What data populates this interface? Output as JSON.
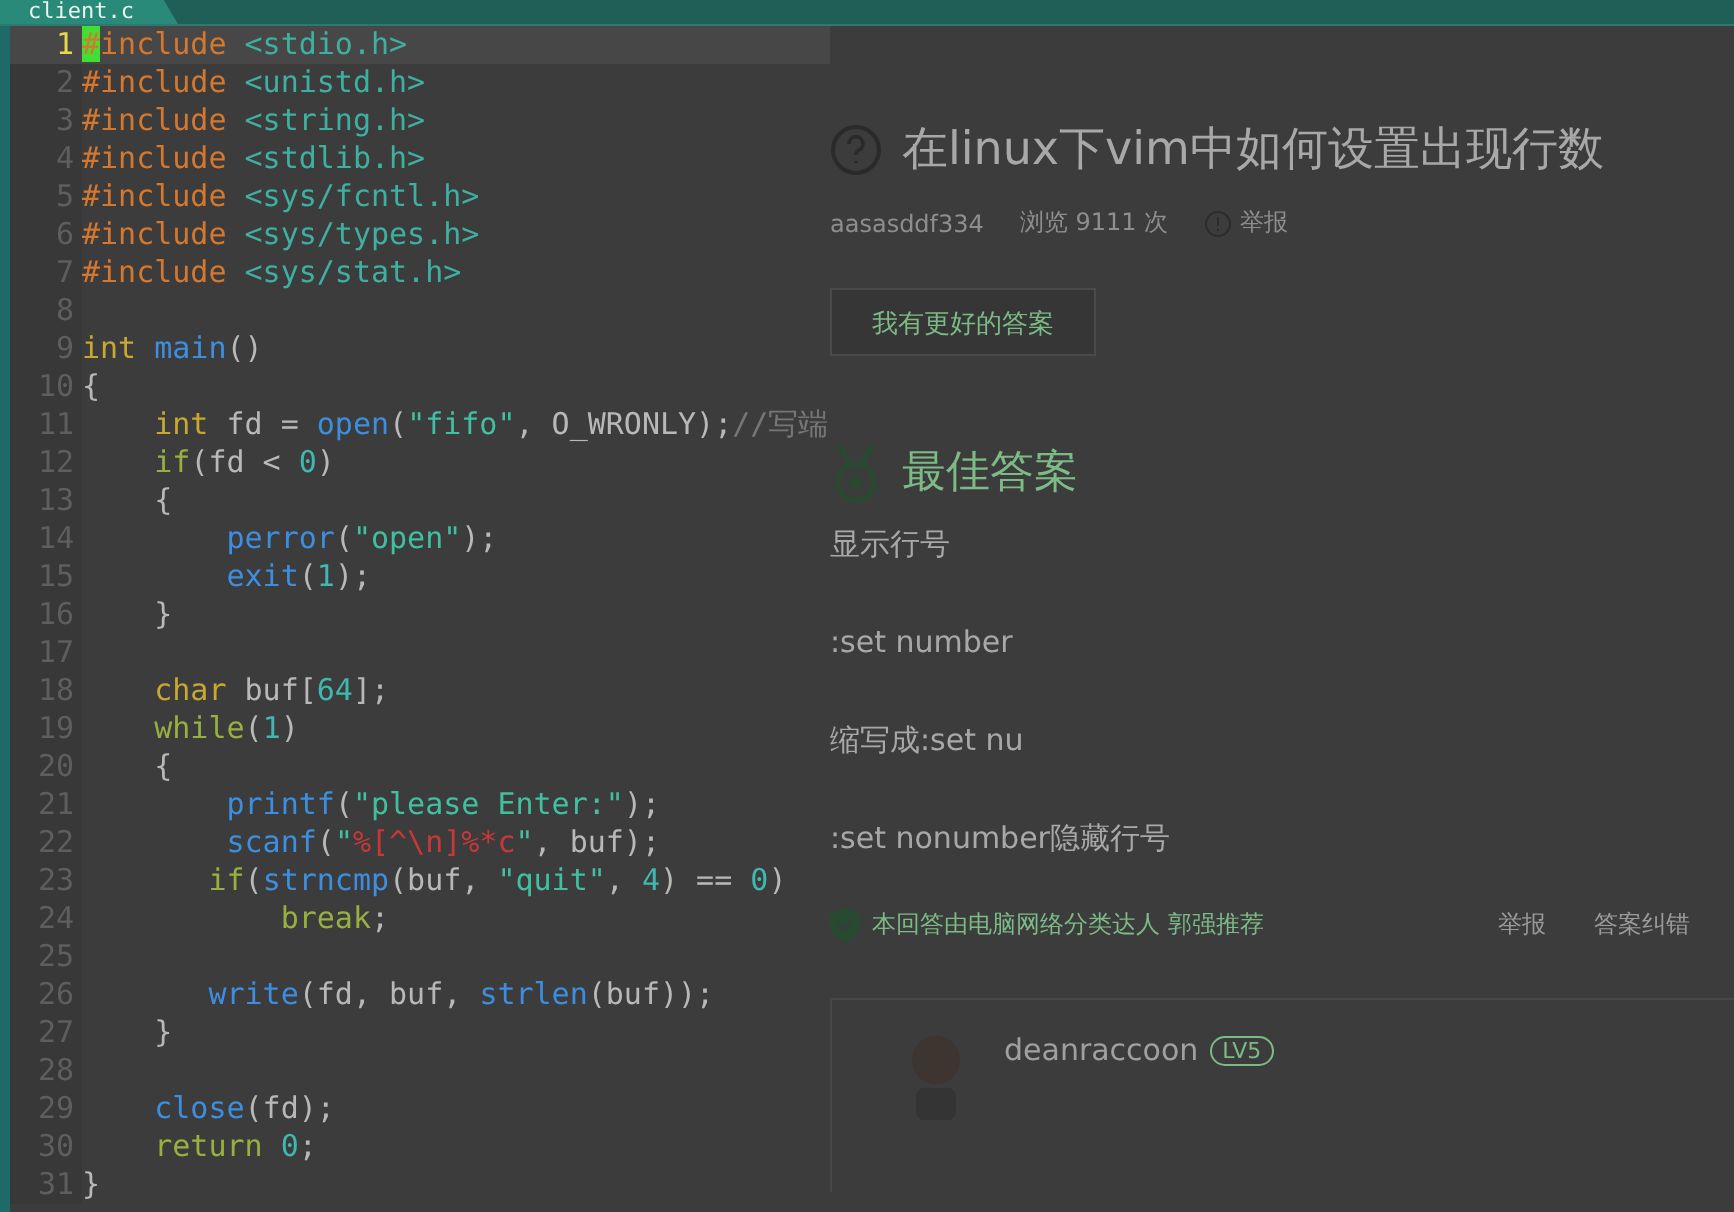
{
  "editor": {
    "tab": {
      "label": "client.c"
    },
    "lines": [
      {
        "number": "1",
        "current": true,
        "tokens": [
          {
            "text": "#",
            "kind": "cursor"
          },
          {
            "text": "include",
            "kind": "preproc"
          },
          {
            "text": " <stdio.h>",
            "kind": "header"
          }
        ]
      },
      {
        "number": "2",
        "current": false,
        "tokens": [
          {
            "text": "#include",
            "kind": "preproc"
          },
          {
            "text": " <unistd.h>",
            "kind": "header"
          }
        ]
      },
      {
        "number": "3",
        "current": false,
        "tokens": [
          {
            "text": "#include",
            "kind": "preproc"
          },
          {
            "text": " <string.h>",
            "kind": "header"
          }
        ]
      },
      {
        "number": "4",
        "current": false,
        "tokens": [
          {
            "text": "#include",
            "kind": "preproc"
          },
          {
            "text": " <stdlib.h>",
            "kind": "header"
          }
        ]
      },
      {
        "number": "5",
        "current": false,
        "tokens": [
          {
            "text": "#include",
            "kind": "preproc"
          },
          {
            "text": " <sys/fcntl.h>",
            "kind": "header"
          }
        ]
      },
      {
        "number": "6",
        "current": false,
        "tokens": [
          {
            "text": "#include",
            "kind": "preproc"
          },
          {
            "text": " <sys/types.h>",
            "kind": "header"
          }
        ]
      },
      {
        "number": "7",
        "current": false,
        "tokens": [
          {
            "text": "#include",
            "kind": "preproc"
          },
          {
            "text": " <sys/stat.h>",
            "kind": "header"
          }
        ]
      },
      {
        "number": "8",
        "current": false
      },
      {
        "number": "9",
        "current": false,
        "tokens": [
          {
            "text": "int",
            "kind": "type"
          },
          {
            "text": " main",
            "kind": "func"
          },
          {
            "text": "()",
            "kind": "plain"
          }
        ]
      },
      {
        "number": "10",
        "current": false,
        "tokens": [
          {
            "text": "{",
            "kind": "plain"
          }
        ]
      },
      {
        "number": "11",
        "current": false,
        "tokens": [
          {
            "text": "    int",
            "kind": "type"
          },
          {
            "text": " fd = ",
            "kind": "plain"
          },
          {
            "text": "open",
            "kind": "func"
          },
          {
            "text": "(",
            "kind": "plain"
          },
          {
            "text": "\"fifo\"",
            "kind": "string"
          },
          {
            "text": ", O_WRONLY);",
            "kind": "plain"
          },
          {
            "text": "//写端",
            "kind": "comment"
          }
        ]
      },
      {
        "number": "12",
        "current": false,
        "tokens": [
          {
            "text": "    if",
            "kind": "keyword"
          },
          {
            "text": "(fd < ",
            "kind": "plain"
          },
          {
            "text": "0",
            "kind": "number"
          },
          {
            "text": ")",
            "kind": "plain"
          }
        ]
      },
      {
        "number": "13",
        "current": false,
        "tokens": [
          {
            "text": "    {",
            "kind": "plain"
          }
        ]
      },
      {
        "number": "14",
        "current": false,
        "tokens": [
          {
            "text": "        perror",
            "kind": "func"
          },
          {
            "text": "(",
            "kind": "plain"
          },
          {
            "text": "\"open\"",
            "kind": "string"
          },
          {
            "text": ");",
            "kind": "plain"
          }
        ]
      },
      {
        "number": "15",
        "current": false,
        "tokens": [
          {
            "text": "        exit",
            "kind": "func"
          },
          {
            "text": "(",
            "kind": "plain"
          },
          {
            "text": "1",
            "kind": "number"
          },
          {
            "text": ");",
            "kind": "plain"
          }
        ]
      },
      {
        "number": "16",
        "current": false,
        "tokens": [
          {
            "text": "    }",
            "kind": "plain"
          }
        ]
      },
      {
        "number": "17",
        "current": false
      },
      {
        "number": "18",
        "current": false,
        "tokens": [
          {
            "text": "    char",
            "kind": "type"
          },
          {
            "text": " buf[",
            "kind": "plain"
          },
          {
            "text": "64",
            "kind": "number"
          },
          {
            "text": "];",
            "kind": "plain"
          }
        ]
      },
      {
        "number": "19",
        "current": false,
        "tokens": [
          {
            "text": "    while",
            "kind": "keyword"
          },
          {
            "text": "(",
            "kind": "plain"
          },
          {
            "text": "1",
            "kind": "number"
          },
          {
            "text": ")",
            "kind": "plain"
          }
        ]
      },
      {
        "number": "20",
        "current": false,
        "tokens": [
          {
            "text": "    {",
            "kind": "plain"
          }
        ]
      },
      {
        "number": "21",
        "current": false,
        "tokens": [
          {
            "text": "        printf",
            "kind": "func"
          },
          {
            "text": "(",
            "kind": "plain"
          },
          {
            "text": "\"please Enter:\"",
            "kind": "string"
          },
          {
            "text": ");",
            "kind": "plain"
          }
        ]
      },
      {
        "number": "22",
        "current": false,
        "tokens": [
          {
            "text": "        scanf",
            "kind": "func"
          },
          {
            "text": "(",
            "kind": "plain"
          },
          {
            "text": "\"",
            "kind": "string"
          },
          {
            "text": "%[^\\n]%*c",
            "kind": "format"
          },
          {
            "text": "\"",
            "kind": "string"
          },
          {
            "text": ", buf);",
            "kind": "plain"
          }
        ]
      },
      {
        "number": "23",
        "current": false,
        "tokens": [
          {
            "text": "       if",
            "kind": "keyword"
          },
          {
            "text": "(",
            "kind": "plain"
          },
          {
            "text": "strncmp",
            "kind": "func"
          },
          {
            "text": "(buf, ",
            "kind": "plain"
          },
          {
            "text": "\"quit\"",
            "kind": "string"
          },
          {
            "text": ", ",
            "kind": "plain"
          },
          {
            "text": "4",
            "kind": "number"
          },
          {
            "text": ") == ",
            "kind": "plain"
          },
          {
            "text": "0",
            "kind": "number"
          },
          {
            "text": ")",
            "kind": "plain"
          }
        ]
      },
      {
        "number": "24",
        "current": false,
        "tokens": [
          {
            "text": "           break",
            "kind": "keyword"
          },
          {
            "text": ";",
            "kind": "plain"
          }
        ]
      },
      {
        "number": "25",
        "current": false
      },
      {
        "number": "26",
        "current": false,
        "tokens": [
          {
            "text": "       write",
            "kind": "func"
          },
          {
            "text": "(fd, buf, ",
            "kind": "plain"
          },
          {
            "text": "strlen",
            "kind": "func"
          },
          {
            "text": "(buf));",
            "kind": "plain"
          }
        ]
      },
      {
        "number": "27",
        "current": false,
        "tokens": [
          {
            "text": "    }",
            "kind": "plain"
          }
        ]
      },
      {
        "number": "28",
        "current": false
      },
      {
        "number": "29",
        "current": false,
        "tokens": [
          {
            "text": "    close",
            "kind": "func"
          },
          {
            "text": "(fd);",
            "kind": "plain"
          }
        ]
      },
      {
        "number": "30",
        "current": false,
        "tokens": [
          {
            "text": "    return",
            "kind": "keyword"
          },
          {
            "text": " 0",
            "kind": "number"
          },
          {
            "text": ";",
            "kind": "plain"
          }
        ]
      },
      {
        "number": "31",
        "current": false,
        "tokens": [
          {
            "text": "}",
            "kind": "plain"
          }
        ]
      }
    ]
  },
  "web_page": {
    "question": {
      "title": "在linux下vim中如何设置出现行数",
      "author": "aasasddf334",
      "views": "浏览 9111 次",
      "report": "举报"
    },
    "answer_button": "我有更好的答案",
    "best_answer": {
      "heading": "最佳答案",
      "paragraphs": [
        "显示行号",
        ":set number",
        "缩写成:set nu",
        ":set nonumber隐藏行号"
      ]
    },
    "recommendation": "本回答由电脑网络分类达人 郭强推荐",
    "actions": [
      "举报",
      "答案纠错"
    ],
    "answerer": {
      "name": "deanraccoon",
      "badge": "LV5"
    }
  }
}
